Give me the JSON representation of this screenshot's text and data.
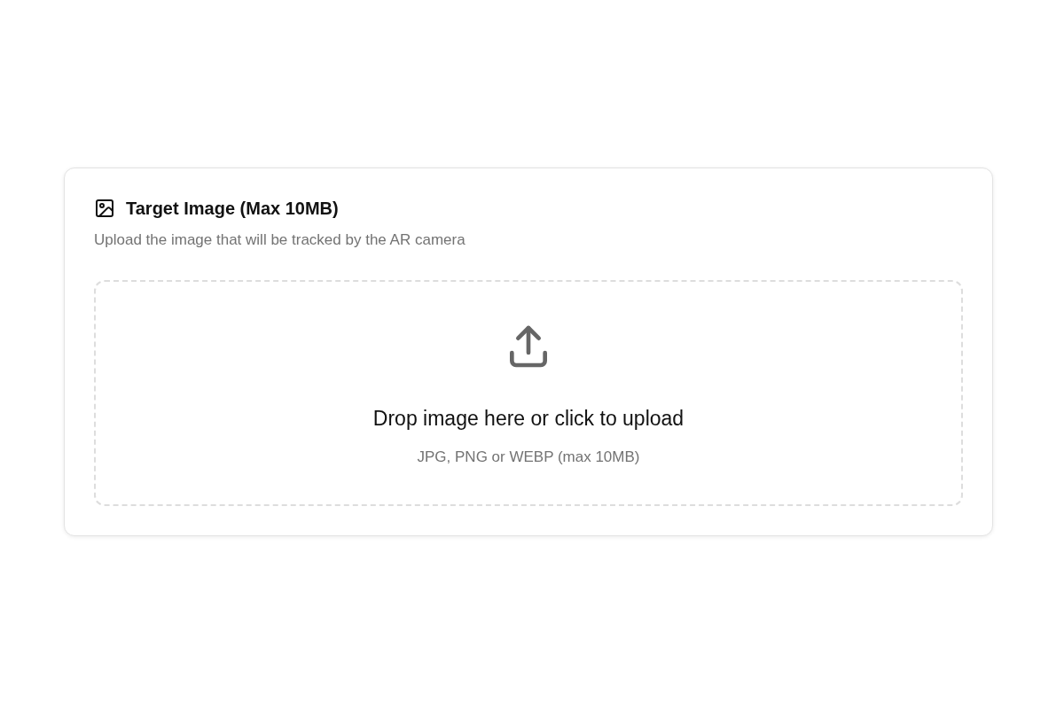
{
  "card": {
    "title": "Target Image (Max 10MB)",
    "description": "Upload the image that will be tracked by the AR camera"
  },
  "dropzone": {
    "prompt": "Drop image here or click to upload",
    "hint": "JPG, PNG or WEBP (max 10MB)"
  }
}
